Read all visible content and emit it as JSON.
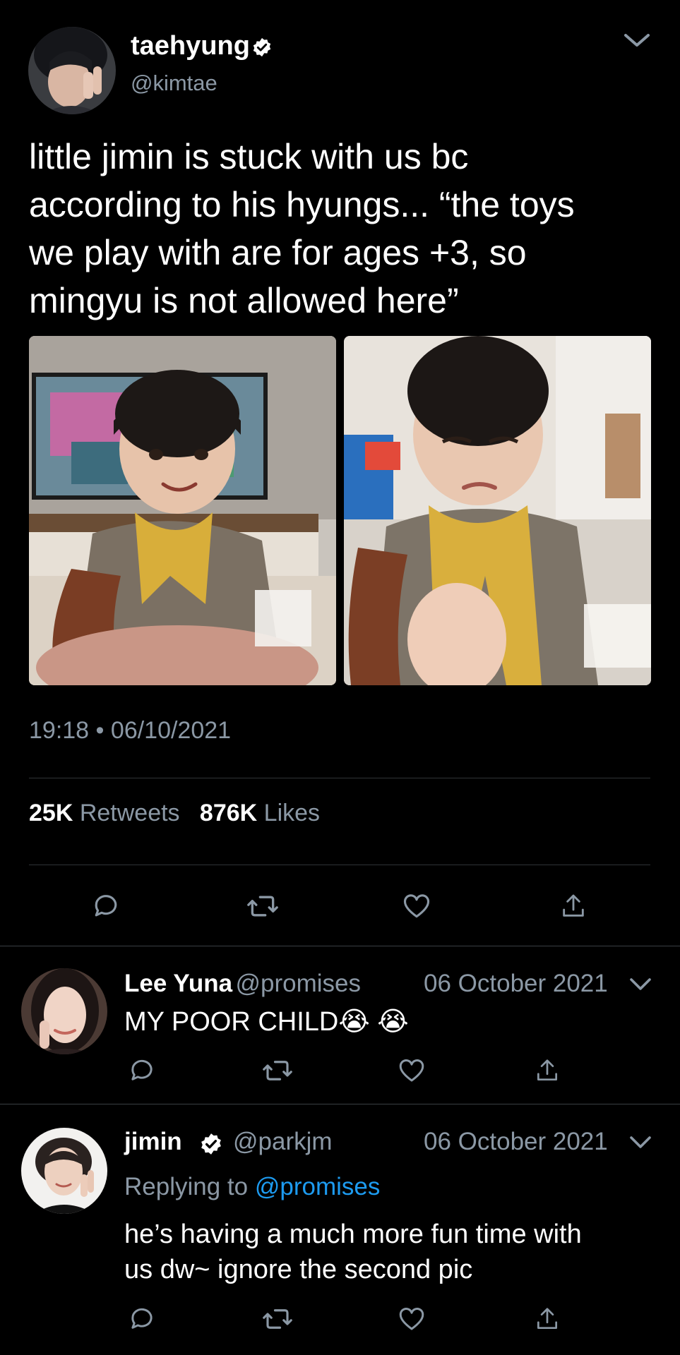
{
  "main_tweet": {
    "author_name": "taehyung",
    "author_handle": "@kimtae",
    "text": "little jimin is stuck with us bc\naccording to his hyungs... “the toys\nwe play with are for ages +3, so\nmingyu is not allowed here”",
    "time": "19:18",
    "separator": "•",
    "date": "06/10/2021",
    "retweets_count": "25K",
    "retweets_label": "Retweets",
    "likes_count": "876K",
    "likes_label": "Likes"
  },
  "replies": [
    {
      "author_name": "Lee Yuna",
      "author_handle": "@promises",
      "date": "06 October 2021",
      "text": "MY POOR CHILD😭 😭"
    },
    {
      "author_name": "jimin",
      "author_handle": "@parkjm",
      "date": "06 October 2021",
      "replying_prefix": "Replying to",
      "replying_to": "@promises",
      "text": "he’s having a much more fun time with\nus dw~ ignore the second pic"
    }
  ],
  "icons": {
    "reply": "speech-bubble-icon",
    "retweet": "retweet-icon",
    "like": "heart-icon",
    "share": "share-icon",
    "verified": "verified-badge-icon",
    "menu": "chevron-down-icon"
  },
  "colors": {
    "background": "#000000",
    "text": "#ffffff",
    "secondary": "#8b98a5",
    "link": "#1d9bf0",
    "divider": "#2f3336"
  }
}
